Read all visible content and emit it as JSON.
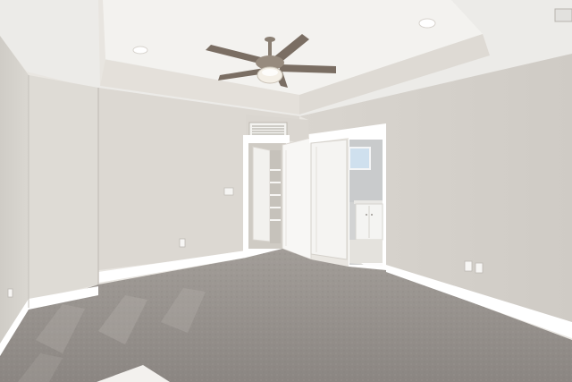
{
  "scene": {
    "subject": "empty-bedroom-interior",
    "elements": [
      "tray-ceiling",
      "ceiling-fan-with-light",
      "recessed-lights",
      "hvac-return-vent",
      "closet-opening-with-shelves",
      "open-white-door",
      "bathroom-doorway",
      "bathroom-window",
      "bathroom-vanity",
      "light-switch",
      "electrical-outlets",
      "white-baseboards",
      "gray-carpet"
    ]
  },
  "colors": {
    "wall_left": "#d9d6d0",
    "wall_back": "#dcd8d2",
    "wall_right": "#d6d2cc",
    "ceiling": "#efedea",
    "tray_band": "#e6e2dc",
    "carpet": "#8d8884",
    "trim": "#ffffff",
    "fan_body": "#8a7f73",
    "fan_blade": "#7a6e63",
    "window_sky": "#cfe0ee"
  }
}
